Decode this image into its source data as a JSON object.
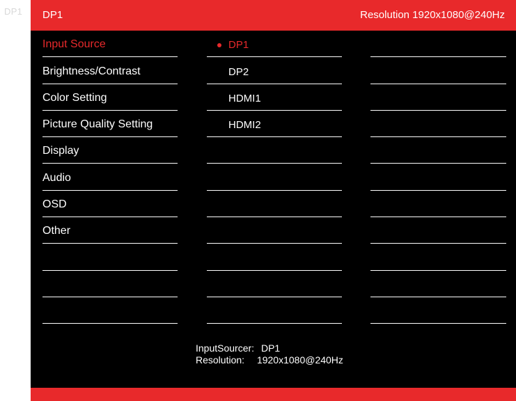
{
  "corner_label": "DP1",
  "header": {
    "title": "DP1",
    "resolution_text": "Resolution 1920x1080@240Hz"
  },
  "menu": {
    "items": [
      {
        "label": "Input Source",
        "active": true
      },
      {
        "label": "Brightness/Contrast",
        "active": false
      },
      {
        "label": "Color Setting",
        "active": false
      },
      {
        "label": "Picture Quality Setting",
        "active": false
      },
      {
        "label": "Display",
        "active": false
      },
      {
        "label": "Audio",
        "active": false
      },
      {
        "label": "OSD",
        "active": false
      },
      {
        "label": "Other",
        "active": false
      },
      {
        "label": "",
        "active": false
      },
      {
        "label": "",
        "active": false
      },
      {
        "label": "",
        "active": false
      }
    ]
  },
  "options": {
    "items": [
      {
        "label": "DP1",
        "selected": true
      },
      {
        "label": "DP2",
        "selected": false
      },
      {
        "label": "HDMI1",
        "selected": false
      },
      {
        "label": "HDMI2",
        "selected": false
      },
      {
        "label": "",
        "selected": false
      },
      {
        "label": "",
        "selected": false
      },
      {
        "label": "",
        "selected": false
      },
      {
        "label": "",
        "selected": false
      },
      {
        "label": "",
        "selected": false
      },
      {
        "label": "",
        "selected": false
      },
      {
        "label": "",
        "selected": false
      }
    ]
  },
  "empty_column_rows": 11,
  "info": {
    "input_label": "InputSourcer:",
    "input_value": "DP1",
    "resolution_label": "Resolution:",
    "resolution_value": "1920x1080@240Hz"
  },
  "colors": {
    "accent": "#e8292b",
    "background": "#000000",
    "text": "#ffffff"
  }
}
